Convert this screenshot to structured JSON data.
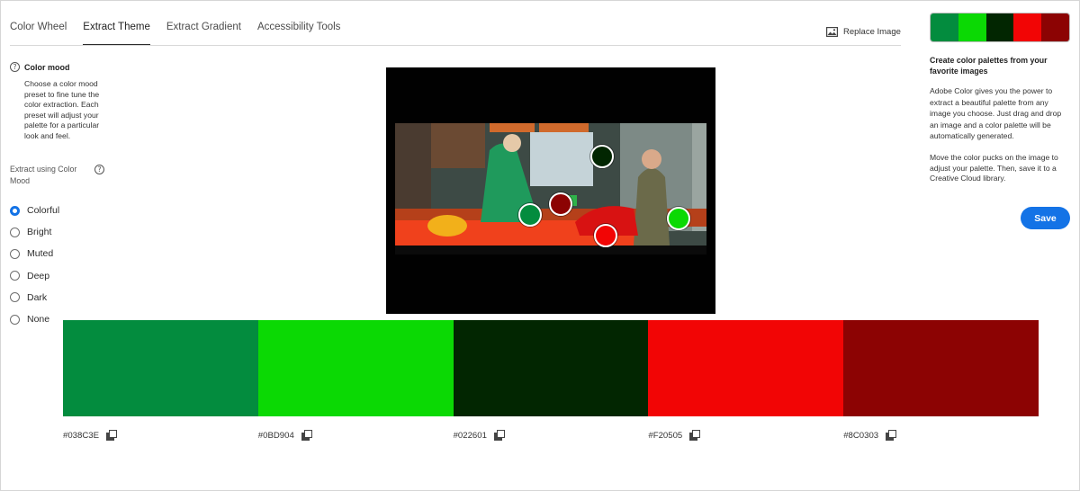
{
  "tabs": [
    {
      "label": "Color Wheel",
      "active": false
    },
    {
      "label": "Extract Theme",
      "active": true
    },
    {
      "label": "Extract Gradient",
      "active": false
    },
    {
      "label": "Accessibility Tools",
      "active": false
    }
  ],
  "replace_image": {
    "label": "Replace Image",
    "icon": "image-icon"
  },
  "left_panel": {
    "mood_title": "Color mood",
    "mood_description": "Choose a color mood preset to fine tune the color extraction. Each preset will adjust your palette for a particular look and feel.",
    "extract_label": "Extract using Color Mood",
    "options": [
      {
        "label": "Colorful",
        "selected": true
      },
      {
        "label": "Bright",
        "selected": false
      },
      {
        "label": "Muted",
        "selected": false
      },
      {
        "label": "Deep",
        "selected": false
      },
      {
        "label": "Dark",
        "selected": false
      },
      {
        "label": "None",
        "selected": false
      }
    ]
  },
  "palette": [
    {
      "hex": "#038C3E",
      "color": "#038C3E"
    },
    {
      "hex": "#0BD904",
      "color": "#0BD904"
    },
    {
      "hex": "#022601",
      "color": "#022601"
    },
    {
      "hex": "#F20505",
      "color": "#F20505"
    },
    {
      "hex": "#8C0303",
      "color": "#8C0303"
    }
  ],
  "right_panel": {
    "title": "Create color palettes from your favorite images",
    "paragraph1": "Adobe Color gives you the power to extract a beautiful palette from any image you choose. Just drag and drop an image and a color palette will be automatically generated.",
    "paragraph2": "Move the color pucks on the image to adjust your palette. Then, save it to a Creative Cloud library.",
    "save_label": "Save"
  },
  "colors": {
    "accent": "#1473E6"
  }
}
